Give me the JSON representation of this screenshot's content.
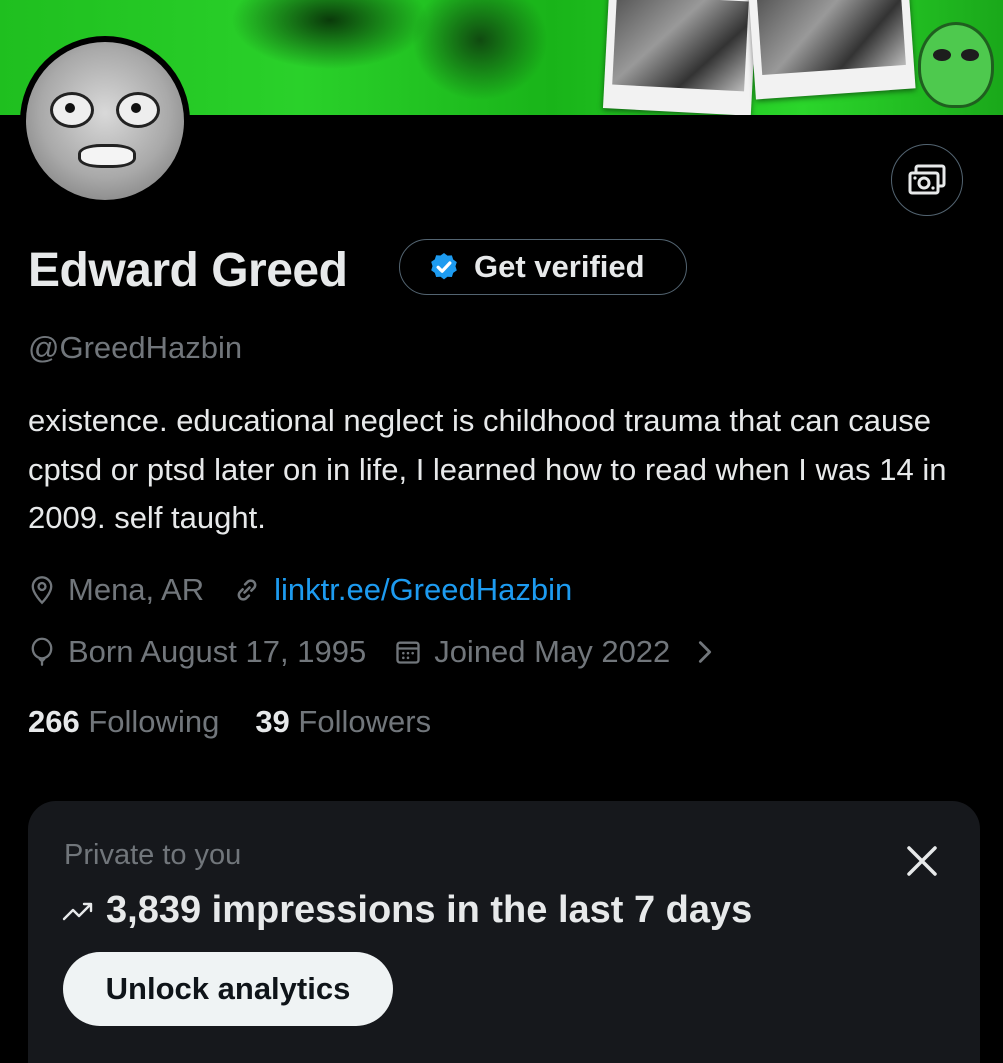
{
  "profile": {
    "name": "Edward Greed",
    "handle": "@GreedHazbin",
    "get_verified_label": "Get verified",
    "bio": "existence. educational neglect is childhood trauma that can cause cptsd or ptsd later on in life,  I learned how to read when I was 14 in 2009. self taught.",
    "location": "Mena, AR",
    "website": "linktr.ee/GreedHazbin",
    "birthday": "Born August 17, 1995",
    "joined": "Joined May 2022",
    "following_count": "266",
    "following_label": "Following",
    "followers_count": "39",
    "followers_label": "Followers"
  },
  "analytics_card": {
    "private_label": "Private to you",
    "impressions_text": "3,839 impressions in the last 7 days",
    "unlock_label": "Unlock analytics"
  },
  "icons": {
    "action_button": "money-icon",
    "verified": "verified-badge-icon",
    "location": "location-pin-icon",
    "link": "link-icon",
    "birthday": "balloon-icon",
    "joined": "calendar-icon",
    "more": "chevron-right-icon",
    "trend": "trending-up-icon",
    "close": "close-icon"
  },
  "colors": {
    "background": "#000000",
    "text_primary": "#e7e9ea",
    "text_secondary": "#71767b",
    "link": "#1d9bf0",
    "card_bg": "#16181c",
    "banner_green": "#22c722"
  }
}
